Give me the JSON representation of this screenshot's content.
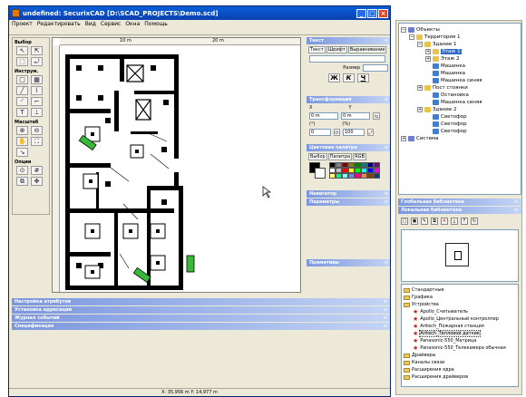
{
  "window": {
    "title": "undefined: SecurixCAD [D:\\SCAD_PROJECTS\\Demo.scd]",
    "btn_min": "_",
    "btn_max": "□",
    "btn_close": "×"
  },
  "menu": [
    "Проект",
    "Редактировать",
    "Вид",
    "Сервис",
    "Окна",
    "Помощь"
  ],
  "toolbox": {
    "sections": [
      "Выбор",
      "Инструм.",
      "Масштаб",
      "Опции"
    ]
  },
  "ruler": {
    "mark_10": "10 m",
    "mark_20": "20 m"
  },
  "props": {
    "text_header": "Текст",
    "text_tabs": [
      "Текст",
      "Шрифт",
      "Выравнивание"
    ],
    "size_label": "Размер",
    "bold": "Ж",
    "italic": "К",
    "underline": "Ч",
    "transform_header": "Трансформация",
    "x_label": "X",
    "y_label": "Y",
    "x_value": "0 m",
    "y_value": "0 m",
    "angle_label": "(°)",
    "pct_label": "(%)",
    "angle_value": "0",
    "pct_value": "100",
    "palette_header": "Цветовая палитра",
    "palette_tabs": [
      "Выбор",
      "Палитра",
      "RGB"
    ],
    "navigator_header": "Навигатор",
    "params_header": "Параметры",
    "primitives_header": "Примитивы",
    "palette_colors": [
      "#000000",
      "#808080",
      "#800000",
      "#808000",
      "#008000",
      "#008080",
      "#000080",
      "#800080",
      "#ffffff",
      "#c0c0c0",
      "#ff0000",
      "#ffff00",
      "#00ff00",
      "#00ffff",
      "#0000ff",
      "#ff00ff",
      "#ffff80",
      "#00ff80",
      "#80ffff",
      "#8080ff",
      "#ff0080",
      "#ff8040",
      "#804000",
      "#004080"
    ]
  },
  "bottom_panels": [
    "Настройка атрибутов",
    "Установка адресации",
    "Журнал событий",
    "Спецификация"
  ],
  "status": {
    "coords": "X: 35,956 m    Y: 14,977 m"
  },
  "tree": [
    {
      "label": "Объекты",
      "depth": 0,
      "exp": "−",
      "color": "#6a7fd0"
    },
    {
      "label": "Территория 1",
      "depth": 1,
      "exp": "−",
      "color": "#e8c44a"
    },
    {
      "label": "Здание 1",
      "depth": 2,
      "exp": "−",
      "color": "#e8c44a"
    },
    {
      "label": "Этаж 1",
      "depth": 3,
      "exp": "+",
      "color": "#e8c44a",
      "selected": true
    },
    {
      "label": "Этаж 2",
      "depth": 3,
      "exp": "+",
      "color": "#e8c44a"
    },
    {
      "label": "Машинка",
      "depth": 3,
      "exp": "",
      "color": "#3a7fd8"
    },
    {
      "label": "Машинка",
      "depth": 3,
      "exp": "",
      "color": "#3a7fd8"
    },
    {
      "label": "Машинка синяя",
      "depth": 3,
      "exp": "",
      "color": "#3a7fd8"
    },
    {
      "label": "Пост стоянки",
      "depth": 2,
      "exp": "+",
      "color": "#e8c44a"
    },
    {
      "label": "Остановка",
      "depth": 3,
      "exp": "",
      "color": "#3a7fd8"
    },
    {
      "label": "Машинка синяя",
      "depth": 3,
      "exp": "",
      "color": "#3a7fd8"
    },
    {
      "label": "Здание 2",
      "depth": 2,
      "exp": "+",
      "color": "#e8c44a"
    },
    {
      "label": "Светофор",
      "depth": 3,
      "exp": "",
      "color": "#3a7fd8"
    },
    {
      "label": "Светофор",
      "depth": 3,
      "exp": "",
      "color": "#3a7fd8"
    },
    {
      "label": "Светофор",
      "depth": 3,
      "exp": "",
      "color": "#3a7fd8"
    },
    {
      "label": "Система",
      "depth": 0,
      "exp": "+",
      "color": "#6a7fd0"
    }
  ],
  "library": {
    "global_header": "Глобальная библиотека",
    "local_header": "Локальная библиотека",
    "items": [
      {
        "label": "Стандартные",
        "kind": "folder"
      },
      {
        "label": "Графика",
        "kind": "folder"
      },
      {
        "label": "Устройства",
        "kind": "folder"
      },
      {
        "label": "Apollo_Считыватель",
        "kind": "device"
      },
      {
        "label": "Apollo_Центральный контроллер",
        "kind": "device"
      },
      {
        "label": "Aritech_Пожарная станция",
        "kind": "device"
      },
      {
        "label": "Aritech_Тепловой датчик",
        "kind": "device",
        "selected": true
      },
      {
        "label": "Panasonic-550_Матрица",
        "kind": "device"
      },
      {
        "label": "Panasonic-550_Телекамера обычная",
        "kind": "device"
      },
      {
        "label": "Драйверы",
        "kind": "folder"
      },
      {
        "label": "Каналы связи",
        "kind": "folder"
      },
      {
        "label": "Расширения ядра",
        "kind": "folder"
      },
      {
        "label": "Расширения драйверов",
        "kind": "folder"
      }
    ]
  },
  "colors": {
    "title_bar": "#0b4fc8",
    "panel_header": "#7a96df",
    "selection": "#316ac5"
  }
}
